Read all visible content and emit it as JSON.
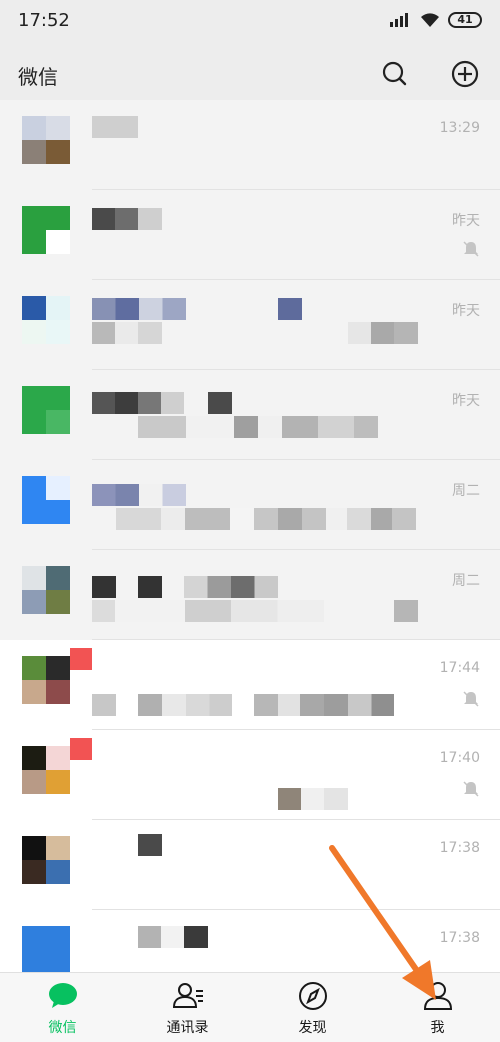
{
  "status_bar": {
    "time": "17:52",
    "battery": "41"
  },
  "header": {
    "title": "微信"
  },
  "chats": [
    {
      "time": "13:29",
      "muted": false
    },
    {
      "time": "昨天",
      "muted": true
    },
    {
      "time": "昨天",
      "muted": false
    },
    {
      "time": "昨天",
      "muted": false
    },
    {
      "time": "周二",
      "muted": false
    },
    {
      "time": "周二",
      "muted": false
    },
    {
      "time": "17:44",
      "muted": true
    },
    {
      "time": "17:40",
      "muted": true
    },
    {
      "time": "17:38",
      "muted": false
    },
    {
      "time": "17:38",
      "muted": false
    }
  ],
  "tabs": [
    {
      "label": "微信",
      "icon": "chat-bubble-icon",
      "active": true
    },
    {
      "label": "通讯录",
      "icon": "contacts-icon",
      "active": false
    },
    {
      "label": "发现",
      "icon": "compass-icon",
      "active": false
    },
    {
      "label": "我",
      "icon": "person-icon",
      "active": false
    }
  ],
  "colors": {
    "accent": "#07c160",
    "arrow": "#f0782a",
    "badge": "#f25353"
  }
}
